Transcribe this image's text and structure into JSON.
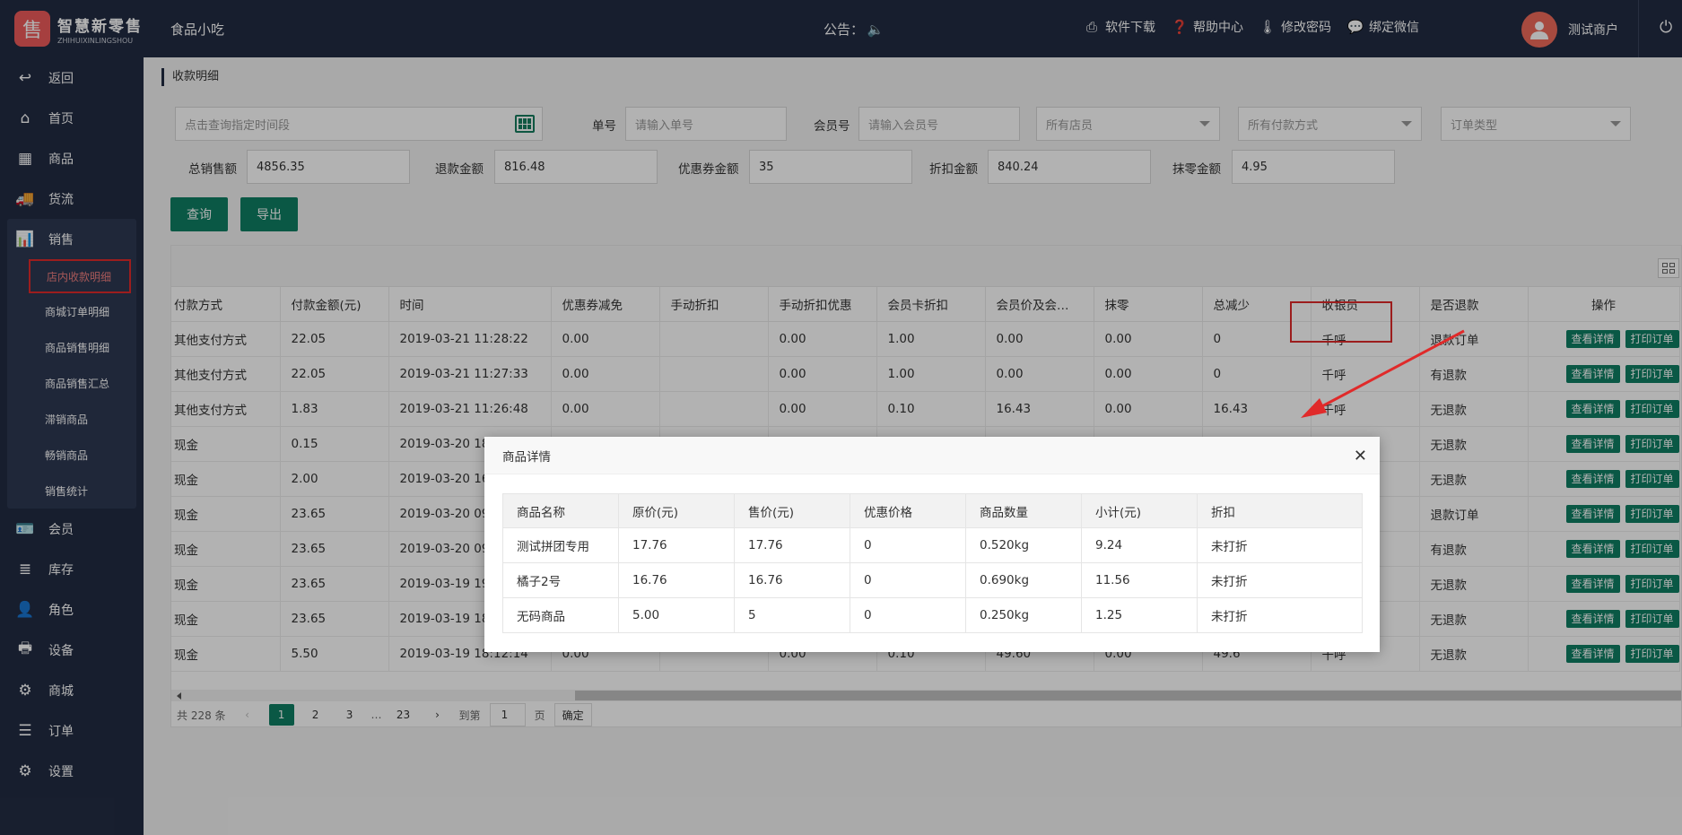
{
  "header": {
    "logo_glyph": "售",
    "logo_name": "智慧新零售",
    "logo_subtitle": "ZHIHUIXINLINGSHOU",
    "shop_name": "食品小吃",
    "notice_label": "公告：",
    "links": [
      {
        "label": "软件下载",
        "icon": "download-icon"
      },
      {
        "label": "帮助中心",
        "icon": "help-icon"
      },
      {
        "label": "修改密码",
        "icon": "thermometer-icon"
      },
      {
        "label": "绑定微信",
        "icon": "wechat-icon"
      }
    ],
    "user_name": "测试商户"
  },
  "sidebar": {
    "items": [
      {
        "label": "返回",
        "icon": "back-icon"
      },
      {
        "label": "首页",
        "icon": "home-icon"
      },
      {
        "label": "商品",
        "icon": "grid-icon"
      },
      {
        "label": "货流",
        "icon": "truck-icon"
      }
    ],
    "sales": {
      "label": "销售",
      "icon": "bar-chart-icon",
      "sub_items": [
        "店内收款明细",
        "商城订单明细",
        "商品销售明细",
        "商品销售汇总",
        "滞销商品",
        "畅销商品",
        "销售统计"
      ],
      "active_index": 0
    },
    "items_after": [
      {
        "label": "会员",
        "icon": "member-card-icon"
      },
      {
        "label": "库存",
        "icon": "database-icon"
      },
      {
        "label": "角色",
        "icon": "user-icon"
      },
      {
        "label": "设备",
        "icon": "printer-icon"
      },
      {
        "label": "商城",
        "icon": "gear-icon"
      },
      {
        "label": "订单",
        "icon": "list-icon"
      },
      {
        "label": "设置",
        "icon": "settings-icon"
      }
    ]
  },
  "page": {
    "breadcrumb": "收款明细",
    "filters": {
      "date_placeholder": "点击查询指定时间段",
      "order_no_label": "单号",
      "order_no_placeholder": "请输入单号",
      "member_no_label": "会员号",
      "member_no_placeholder": "请输入会员号",
      "store_select": "所有店员",
      "payment_select": "所有付款方式",
      "order_type_select": "订单类型"
    },
    "summary": {
      "total_sales_label": "总销售额",
      "total_sales": "4856.35",
      "refund_label": "退款金额",
      "refund": "816.48",
      "coupon_label": "优惠券金额",
      "coupon": "35",
      "discount_label": "折扣金额",
      "discount": "840.24",
      "rounding_label": "抹零金额",
      "rounding": "4.95"
    },
    "buttons": {
      "query": "查询",
      "export": "导出"
    }
  },
  "table": {
    "columns": [
      "付款方式",
      "付款金额(元)",
      "时间",
      "优惠券减免",
      "手动折扣",
      "手动折扣优惠",
      "会员卡折扣",
      "会员价及会…",
      "抹零",
      "总减少",
      "收银员",
      "是否退款",
      "操作"
    ],
    "rows": [
      [
        "其他支付方式",
        "22.05",
        "2019-03-21 11:28:22",
        "0.00",
        "",
        "0.00",
        "1.00",
        "0.00",
        "0.00",
        "0",
        "千呼",
        "退款订单"
      ],
      [
        "其他支付方式",
        "22.05",
        "2019-03-21 11:27:33",
        "0.00",
        "",
        "0.00",
        "1.00",
        "0.00",
        "0.00",
        "0",
        "千呼",
        "有退款"
      ],
      [
        "其他支付方式",
        "1.83",
        "2019-03-21 11:26:48",
        "0.00",
        "",
        "0.00",
        "0.10",
        "16.43",
        "0.00",
        "16.43",
        "千呼",
        "无退款"
      ],
      [
        "现金",
        "0.15",
        "2019-03-20 18:0",
        "",
        "",
        "",
        "",
        "",
        "",
        "",
        "",
        "无退款"
      ],
      [
        "现金",
        "2.00",
        "2019-03-20 16:1",
        "",
        "",
        "",
        "",
        "",
        "",
        "",
        "",
        "无退款"
      ],
      [
        "现金",
        "23.65",
        "2019-03-20 09:0",
        "",
        "",
        "",
        "",
        "",
        "",
        "",
        "",
        "退款订单"
      ],
      [
        "现金",
        "23.65",
        "2019-03-20 09:0",
        "",
        "",
        "",
        "",
        "",
        "",
        "",
        "",
        "有退款"
      ],
      [
        "现金",
        "23.65",
        "2019-03-19 19:1",
        "",
        "",
        "",
        "",
        "",
        "",
        "",
        "",
        "无退款"
      ],
      [
        "现金",
        "23.65",
        "2019-03-19 18:5",
        "",
        "",
        "",
        "",
        "",
        "",
        "",
        "",
        "无退款"
      ],
      [
        "现金",
        "5.50",
        "2019-03-19 18:12:14",
        "0.00",
        "",
        "0.00",
        "0.10",
        "49.60",
        "0.00",
        "49.6",
        "千呼",
        "无退款"
      ]
    ],
    "view_btn": "查看详情",
    "print_btn": "打印订单"
  },
  "pagination": {
    "total": "共 228 条",
    "pages": [
      "1",
      "2",
      "3"
    ],
    "ellipsis": "…",
    "last": "23",
    "goto_label": "到第",
    "goto_value": "1",
    "page_unit": "页",
    "confirm": "确定"
  },
  "modal": {
    "title": "商品详情",
    "columns": [
      "商品名称",
      "原价(元)",
      "售价(元)",
      "优惠价格",
      "商品数量",
      "小计(元)",
      "折扣"
    ],
    "rows": [
      [
        "测试拼团专用",
        "17.76",
        "17.76",
        "0",
        "0.520kg",
        "9.24",
        "未打折"
      ],
      [
        "橘子2号",
        "16.76",
        "16.76",
        "0",
        "0.690kg",
        "11.56",
        "未打折"
      ],
      [
        "无码商品",
        "5.00",
        "5",
        "0",
        "0.250kg",
        "1.25",
        "未打折"
      ]
    ]
  },
  "colors": {
    "accent": "#0f7f63",
    "sidebar": "#222c43",
    "highlight": "#e02a2a"
  }
}
